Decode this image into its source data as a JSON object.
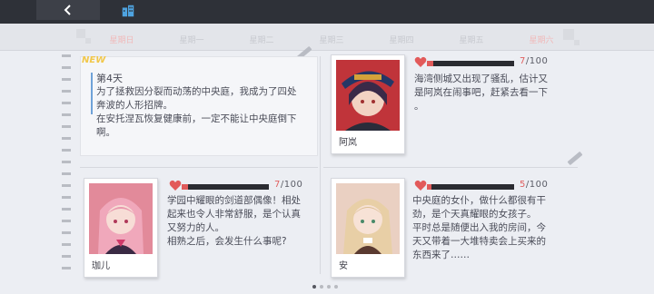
{
  "weekdays": [
    {
      "label": "星期日",
      "active": true
    },
    {
      "label": "星期一",
      "active": false
    },
    {
      "label": "星期二",
      "active": false
    },
    {
      "label": "星期三",
      "active": false
    },
    {
      "label": "星期四",
      "active": false
    },
    {
      "label": "星期五",
      "active": false
    },
    {
      "label": "星期六",
      "active": true
    }
  ],
  "diary": {
    "badge": "NEW",
    "day_title": "第4天",
    "line1": "为了拯救因分裂而动荡的中央庭，我成为了四处",
    "line2": "奔波的人形招牌。",
    "line3": "在安托涅瓦恢复健康前，一定不能让中央庭倒下",
    "line4": "啊。"
  },
  "characters": [
    {
      "name": "阿岚",
      "affection": "7",
      "affection_max": "/100",
      "affection_fraction": 0.07,
      "lines": [
        "海湾侧城又出现了骚乱，估计又",
        "是阿岚在闹事吧，赶紧去看一下",
        "。"
      ]
    },
    {
      "name": "珈儿",
      "affection": "7",
      "affection_max": "/100",
      "affection_fraction": 0.07,
      "lines": [
        "学园中耀眼的剑道部偶像！相处",
        "起来也令人非常舒服，是个认真",
        "又努力的人。",
        "相熟之后，会发生什么事呢?"
      ]
    },
    {
      "name": "安",
      "affection": "5",
      "affection_max": "/100",
      "affection_fraction": 0.05,
      "lines": [
        "中央庭的女仆，做什么都很有干",
        "劲，是个天真耀眼的女孩子。",
        "平时总是随便出入我的房间，今",
        "天又带着一大堆特卖会上买来的",
        "东西来了……"
      ]
    }
  ],
  "colors": {
    "topbar": "#2e3138",
    "accent_blue": "#6fa2d8",
    "affection_red": "#e05a5a",
    "active_day": "#f0b9b9"
  },
  "icons": [
    "back-arrow-icon",
    "home-icon",
    "heart-icon"
  ],
  "pager": {
    "count": 4,
    "current": 1
  }
}
